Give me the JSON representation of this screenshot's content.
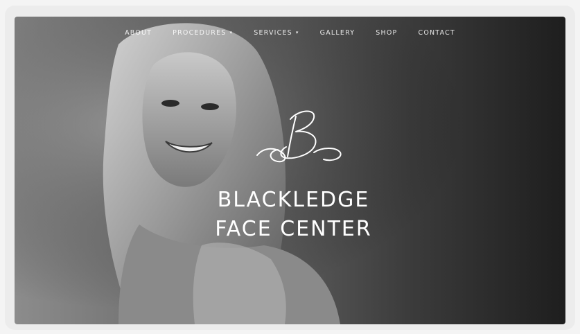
{
  "nav": {
    "items": [
      {
        "label": "ABOUT",
        "has_dropdown": false
      },
      {
        "label": "PROCEDURES",
        "has_dropdown": true
      },
      {
        "label": "SERVICES",
        "has_dropdown": true
      },
      {
        "label": "GALLERY",
        "has_dropdown": false
      },
      {
        "label": "SHOP",
        "has_dropdown": false
      },
      {
        "label": "CONTACT",
        "has_dropdown": false
      }
    ],
    "dropdown_glyph": "▾"
  },
  "brand": {
    "line1": "BLACKLEDGE",
    "line2": "FACE CENTER",
    "monogram": "B",
    "color": "#ffffff"
  },
  "hero": {
    "image_subject": "black-and-white portrait of smiling woman with long hair",
    "colors": {
      "left": "#8c8c8c",
      "right": "#1e1e1e"
    }
  }
}
